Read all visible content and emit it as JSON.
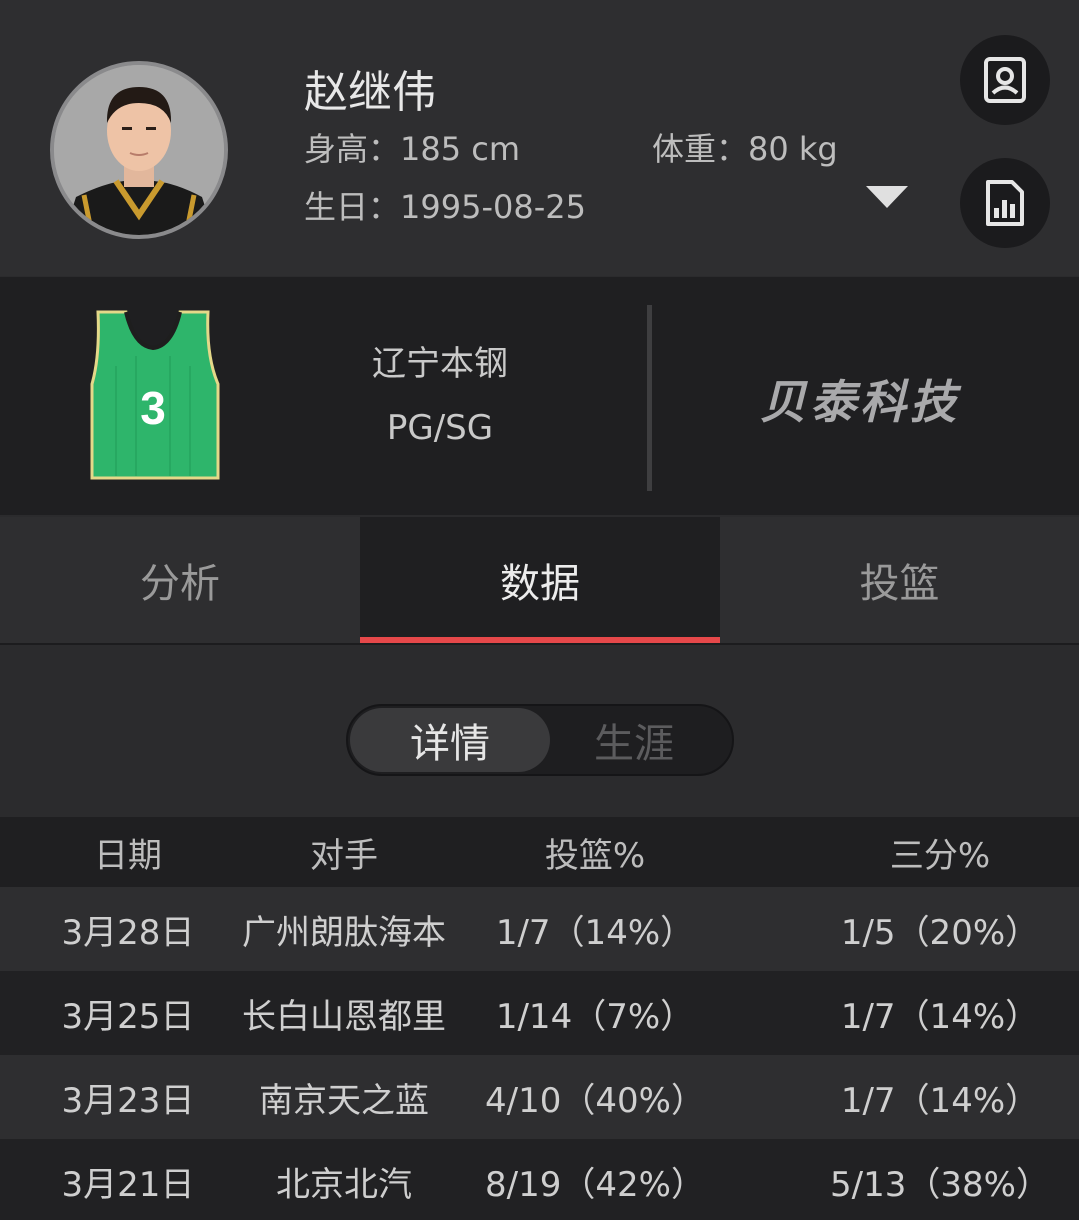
{
  "player": {
    "name": "赵继伟",
    "height": "身高：185 cm",
    "weight": "体重：80 kg",
    "birthday": "生日：1995-08-25"
  },
  "team": {
    "name": "辽宁本钢",
    "position": "PG/SG",
    "jersey_number": "3",
    "jersey_color": "#2eb56b",
    "sponsor": "贝泰科技"
  },
  "icons": {
    "profile": "profile-card-icon",
    "report": "bar-report-icon",
    "expand": "chevron-down-icon"
  },
  "tabs": [
    {
      "label": "分析",
      "active": false
    },
    {
      "label": "数据",
      "active": true
    },
    {
      "label": "投篮",
      "active": false
    }
  ],
  "accent_color": "#e6484a",
  "segment": {
    "detail": "详情",
    "career": "生涯",
    "selected": "详情"
  },
  "table": {
    "headers": [
      "日期",
      "对手",
      "投篮%",
      "三分%"
    ],
    "rows": [
      {
        "date": "3月28日",
        "opponent": "广州朗肽海本",
        "fg": "1/7（14%）",
        "three": "1/5（20%）"
      },
      {
        "date": "3月25日",
        "opponent": "长白山恩都里",
        "fg": "1/14（7%）",
        "three": "1/7（14%）"
      },
      {
        "date": "3月23日",
        "opponent": "南京天之蓝",
        "fg": "4/10（40%）",
        "three": "1/7（14%）"
      },
      {
        "date": "3月21日",
        "opponent": "北京北汽",
        "fg": "8/19（42%）",
        "three": "5/13（38%）"
      }
    ]
  }
}
